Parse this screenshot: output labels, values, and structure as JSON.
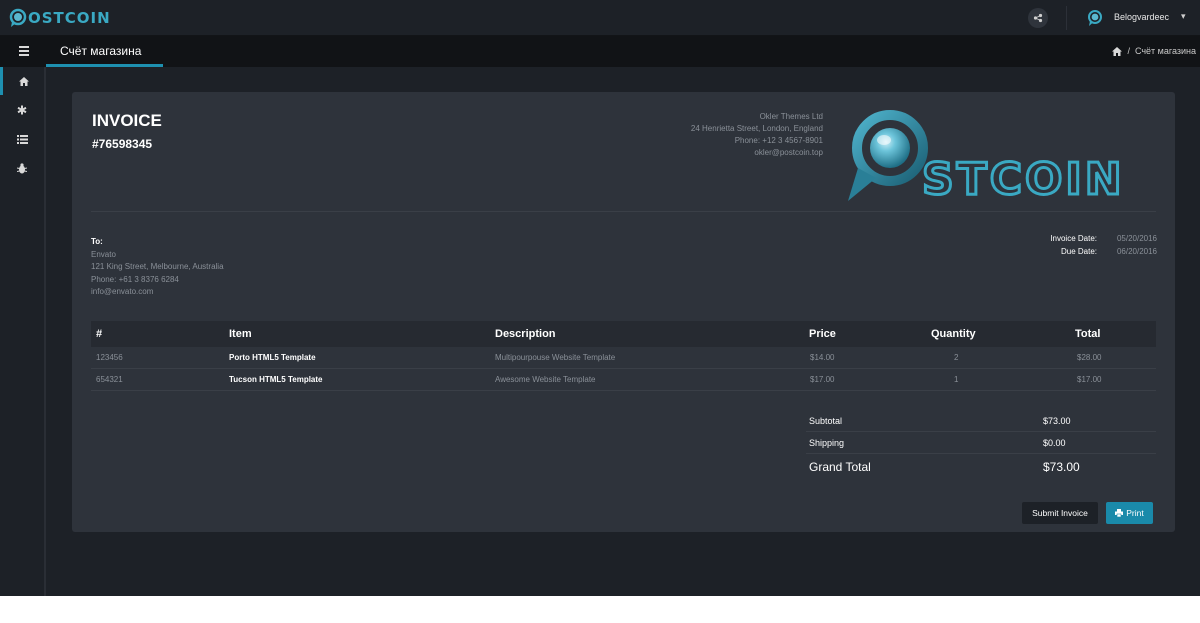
{
  "app": {
    "logo_text": "OSTCOIN"
  },
  "topbar": {
    "user_name": "Belogvardeec",
    "caret": "▾"
  },
  "pagebar": {
    "title": "Счёт магазина",
    "breadcrumb_sep": "/",
    "breadcrumb_current": "Счёт магазина"
  },
  "sidebar": {
    "items": [
      "home-icon",
      "asterisk-icon",
      "list-icon",
      "bug-icon"
    ]
  },
  "invoice": {
    "title": "INVOICE",
    "number": "#76598345",
    "company": {
      "name": "Okler Themes Ltd",
      "address": "24 Henrietta Street, London, England",
      "phone": "Phone: +12 3 4567-8901",
      "email": "okler@postcoin.top"
    },
    "to": {
      "label": "To:",
      "name": "Envato",
      "address": "121 King Street, Melbourne, Australia",
      "phone": "Phone: +61 3 8376 6284",
      "email": "info@envato.com"
    },
    "dates": {
      "invoice_label": "Invoice Date:",
      "invoice_value": "05/20/2016",
      "due_label": "Due Date:",
      "due_value": "06/20/2016"
    },
    "table": {
      "headers": [
        "#",
        "Item",
        "Description",
        "Price",
        "Quantity",
        "Total"
      ],
      "rows": [
        [
          "123456",
          "Porto HTML5 Template",
          "Multipourpouse Website Template",
          "$14.00",
          "2",
          "$28.00"
        ],
        [
          "654321",
          "Tucson HTML5 Template",
          "Awesome Website Template",
          "$17.00",
          "1",
          "$17.00"
        ]
      ]
    },
    "totals": {
      "subtotal_label": "Subtotal",
      "subtotal_value": "$73.00",
      "shipping_label": "Shipping",
      "shipping_value": "$0.00",
      "grand_label": "Grand Total",
      "grand_value": "$73.00"
    },
    "buttons": {
      "submit": "Submit Invoice",
      "print": "Print"
    }
  },
  "colors": {
    "accent": "#1e90b0",
    "background": "#1d2127",
    "card": "#2e333b"
  }
}
